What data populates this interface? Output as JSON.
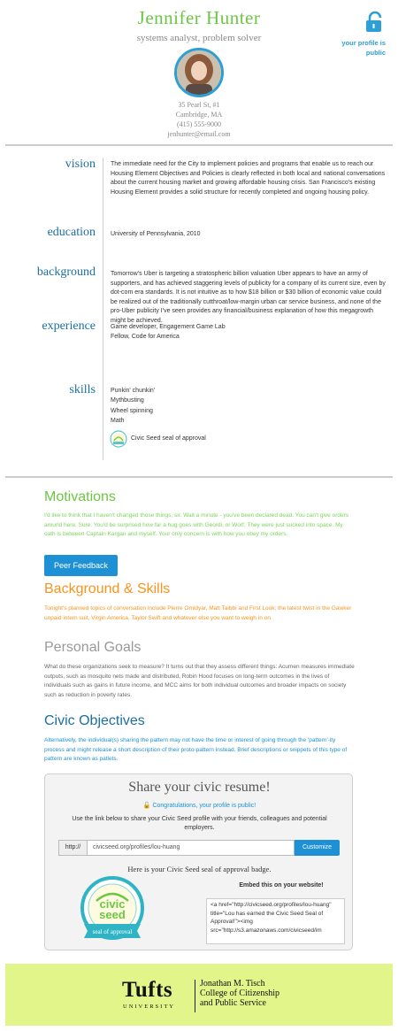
{
  "profile": {
    "name": "Jennifer Hunter",
    "tagline": "systems analyst, problem solver",
    "address_line1": "35 Pearl St, #1",
    "address_line2": "Cambridge, MA",
    "phone": "(415) 555-9000",
    "email": "jenhunter@email.com",
    "public_note": "your profile is public"
  },
  "resume": {
    "vision": {
      "label": "vision",
      "text": "The immediate need for the City to implement policies and programs that enable us to reach our Housing Element Objectives and Policies is clearly reflected in both local and national conversations about the current housing market and growing affordable housing crisis. San Francisco's existing Housing Element provides a solid structure for recently completed and ongoing housing policy."
    },
    "education": {
      "label": "education",
      "text": "University of Pennsylvania, 2010"
    },
    "background": {
      "label": "background",
      "text": "Tomorrow's Uber is targeting a stratospheric billion valuation Uber appears to have an army of supporters, and has achieved staggering levels of publicity for a company of its current size, even by dot-com era standards. It is not intuitive as to how $18 billion or $30 billion of economic value could be realized out of the traditionally cutthroat/low-margin urban car service business, and none of the pro-Uber publicity I've seen provides any financial/business explanation of how this megagrowth might be achieved."
    },
    "experience": {
      "label": "experience",
      "items": [
        "Game developer, Engagement Game Lab",
        "Fellow, Code for America"
      ]
    },
    "skills": {
      "label": "skills",
      "items": [
        "Punkin' chunkin'",
        "Mythbusting",
        "Wheel spinning",
        "Math"
      ]
    },
    "seal_label": "Civic Seed seal of approval"
  },
  "sections": {
    "motivations": {
      "title": "Motivations",
      "text": "I'd like to think that I haven't changed those things, sir. Wait a minute - you've been declared dead. You can't give orders around here. Sure. You'd be surprised how far a hug goes with Geordi, or Worf. They were just sucked into space. My oath is between Captain Kargan and myself. Your only concern is with how you obey my orders."
    },
    "peer_feedback_button": "Peer Feedback",
    "background_skills": {
      "title": "Background & Skills",
      "text": "Tonight's planned topics of conversation include Pierre Omidyar, Matt Taibbi and First Look; the latest twist in the Gawker unpaid intern suit, Virgin America, Taylor Swift and whatever else you want to weigh in on."
    },
    "personal_goals": {
      "title": "Personal Goals",
      "text": "What do these organizations seek to measure? It turns out that they assess different things: Acumen measures immediate outputs, such as mosquito nets made and distributed, Robin Hood focuses on long-term outcomes in the lives of individuals such as gains in future income, and MCC aims for both individual outcomes and broader impacts on society such as reduction in poverty rates."
    },
    "civic_objectives": {
      "title": "Civic Objectives",
      "text": "Alternatively, the individual(s) sharing the pattern may not have the time or interest of going through the 'pattern'-ity process and might release a short description of their proto-pattern instead. Brief descriptions or snippets of this type of pattern are known as patlets."
    }
  },
  "share": {
    "title": "Share your civic resume!",
    "congrats": "Congratulations, your profile is public!",
    "description": "Use the link below to share your Civic Seed profile with your friends, colleagues and potential employers.",
    "url_prefix": "http://",
    "url_value": "civicseed.org/profiles/lou-huang",
    "customize_label": "Customize",
    "seal_heading": "Here is your Civic Seed seal of approval badge.",
    "embed_heading": "Embed this on your website!",
    "embed_code": "<a href=\"http://civicseed.org/profiles/lou-huang\" title=\"Lou has earned the Civic Seed Seal of Approval!\"><img src=\"http://s3.amazonaws.com/civicseed/im"
  },
  "badge": {
    "word1": "civic",
    "word2": "seed",
    "ribbon": "seal of approval"
  },
  "footer": {
    "logo_word": "Tufts",
    "logo_sub": "UNIVERSITY",
    "college_line1": "Jonathan M. Tisch",
    "college_line2": "College of Citizenship",
    "college_line3": "and Public Service"
  },
  "colors": {
    "green": "#6cc644",
    "blue": "#1e90d6",
    "orange": "#f7941e",
    "dark_blue": "#1a6fa0",
    "gray_heading": "#888888",
    "footer_bg": "#e2f58a"
  },
  "icons": {
    "lock": "unlocked-padlock-icon"
  }
}
